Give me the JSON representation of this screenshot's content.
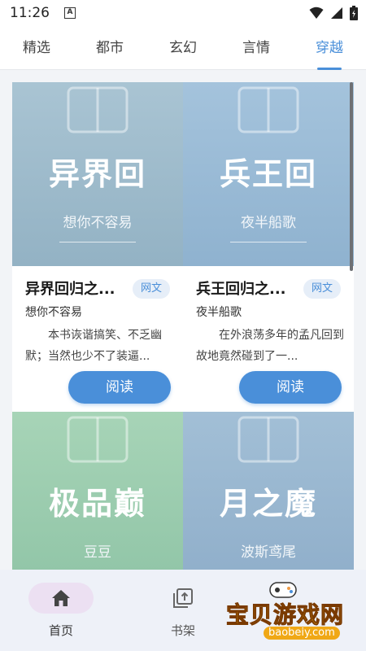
{
  "status_bar": {
    "time": "11:26",
    "notification": "A"
  },
  "tabs": [
    {
      "label": "精选",
      "active": false
    },
    {
      "label": "都市",
      "active": false
    },
    {
      "label": "玄幻",
      "active": false
    },
    {
      "label": "言情",
      "active": false
    },
    {
      "label": "穿越",
      "active": true
    }
  ],
  "books": [
    {
      "cover_title": "异界回",
      "cover_author": "想你不容易",
      "title": "异界回归之...",
      "tag": "网文",
      "author": "想你不容易",
      "description": "本书诙谐搞笑、不乏幽默；当然也少不了装逼...",
      "read_label": "阅读"
    },
    {
      "cover_title": "兵王回",
      "cover_author": "夜半船歌",
      "title": "兵王回归之...",
      "tag": "网文",
      "author": "夜半船歌",
      "description": "在外浪荡多年的孟凡回到故地竟然碰到了一...",
      "read_label": "阅读"
    },
    {
      "cover_title": "极品巅",
      "cover_author": "豆豆"
    },
    {
      "cover_title": "月之魔",
      "cover_author": "波斯鸢尾"
    }
  ],
  "bottom_nav": [
    {
      "label": "首页",
      "icon": "home-icon",
      "active": true
    },
    {
      "label": "书架",
      "icon": "bookshelf-icon",
      "active": false
    }
  ],
  "watermark": {
    "text": "宝贝游戏网",
    "url": "baobeiy.com"
  },
  "colors": {
    "accent": "#4a8fd9",
    "tag_bg": "#e6eef8",
    "nav_bg": "#eef1f8"
  }
}
